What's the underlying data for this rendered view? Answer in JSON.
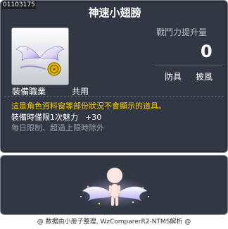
{
  "item": {
    "id": "01103175",
    "name": "神速小翅膀",
    "power_label": "戰鬥力提升量",
    "power_value": "0",
    "tags": [
      "防具",
      "披風"
    ],
    "job_label": "裝備職業",
    "job_value": "共用",
    "warning": "這是角色資料窗等部份狀況不會顯示的道具。",
    "effect_text": "裝備時僅限1次魅力",
    "effect_bonus": "+30",
    "limit_text": "每日限制、超過上限時除外"
  },
  "footer": {
    "text": "@ 数据由小册子整理, WzComparerR2-NTMS解析 @"
  },
  "colors": {
    "panel_bg": "#323843",
    "panel_border": "#7d838c",
    "warning": "#ffcc00",
    "muted": "#9a9fa7"
  },
  "icons": [
    "wing-item-icon",
    "gold-coin-icon",
    "character-preview"
  ]
}
